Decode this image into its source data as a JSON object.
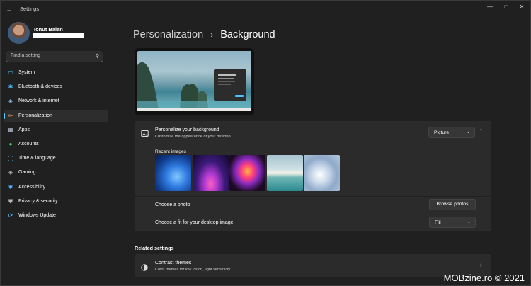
{
  "window": {
    "title": "Settings"
  },
  "profile": {
    "name": "Ionut Balan"
  },
  "search": {
    "placeholder": "Find a setting"
  },
  "sidebar": {
    "items": [
      {
        "label": "System",
        "icon": "system-icon",
        "color": "#4cc2ff",
        "active": false
      },
      {
        "label": "Bluetooth & devices",
        "icon": "bluetooth-icon",
        "color": "#4cc2ff",
        "active": false
      },
      {
        "label": "Network & internet",
        "icon": "wifi-icon",
        "color": "#9fd5ff",
        "active": false
      },
      {
        "label": "Personalization",
        "icon": "brush-icon",
        "color": "#f1a06b",
        "active": true
      },
      {
        "label": "Apps",
        "icon": "apps-icon",
        "color": "#b8c8d8",
        "active": false
      },
      {
        "label": "Accounts",
        "icon": "accounts-icon",
        "color": "#4cd964",
        "active": false
      },
      {
        "label": "Time & language",
        "icon": "globe-clock-icon",
        "color": "#4cc2ff",
        "active": false
      },
      {
        "label": "Gaming",
        "icon": "gamepad-icon",
        "color": "#c8c8c8",
        "active": false
      },
      {
        "label": "Accessibility",
        "icon": "accessibility-icon",
        "color": "#5fb3ff",
        "active": false
      },
      {
        "label": "Privacy & security",
        "icon": "shield-icon",
        "color": "#b8b8b8",
        "active": false
      },
      {
        "label": "Windows Update",
        "icon": "update-icon",
        "color": "#4cc2ff",
        "active": false
      }
    ]
  },
  "breadcrumb": {
    "parent": "Personalization",
    "separator": "›",
    "current": "Background"
  },
  "personalize": {
    "title": "Personalize your background",
    "subtitle": "Customize the appearance of your desktop",
    "type_value": "Picture",
    "recent_label": "Recent images",
    "choose_photo_label": "Choose a photo",
    "browse_label": "Browse photos",
    "fit_label": "Choose a fit for your desktop image",
    "fit_value": "Fill"
  },
  "related": {
    "heading": "Related settings",
    "contrast_title": "Contrast themes",
    "contrast_subtitle": "Color themes for low vision, light sensitivity"
  },
  "watermark": "MOBzine.ro © 2021",
  "accent": "#60cdff"
}
